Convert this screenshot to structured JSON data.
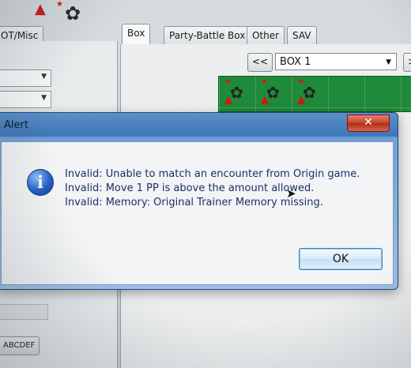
{
  "tabs": {
    "ot_misc": "OT/Misc",
    "box": "Box",
    "party_battle_box": "Party-Battle Box",
    "other": "Other",
    "sav": "SAV"
  },
  "box": {
    "prev_label": "<<",
    "next_label": ">",
    "selected": "BOX 1"
  },
  "left": {
    "abc_button": "ABCDEF"
  },
  "alert": {
    "title": "Alert",
    "close_label": "✕",
    "messages": [
      "Invalid: Unable to match an encounter from Origin game.",
      "Invalid: Move 1 PP is above the amount allowed.",
      "Invalid: Memory: Original Trainer Memory missing."
    ],
    "ok_label": "OK"
  },
  "colors": {
    "box_grid": "#1f8a3a",
    "warning": "#d11111",
    "info": "#2761c4"
  },
  "icons": [
    "warning-icon",
    "star-icon",
    "pokemon-sprite-icon",
    "info-icon",
    "close-icon",
    "chevron-down-icon",
    "cursor-icon"
  ]
}
